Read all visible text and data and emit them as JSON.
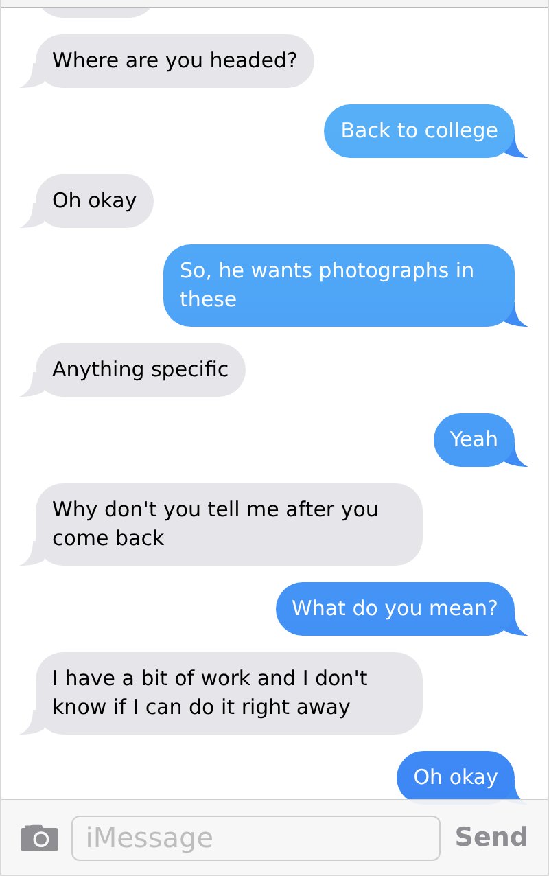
{
  "messages": [
    {
      "kind": "received"
    },
    {
      "kind": "received",
      "text": "Where are you headed?"
    },
    {
      "kind": "sent",
      "text": "Back to college"
    },
    {
      "kind": "received",
      "text": "Oh okay"
    },
    {
      "kind": "sent",
      "text": "So, he wants photographs in these"
    },
    {
      "kind": "received",
      "text": "Anything specific"
    },
    {
      "kind": "sent",
      "text": "Yeah"
    },
    {
      "kind": "received",
      "text": "Why don't you tell me after you come back"
    },
    {
      "kind": "sent",
      "text": "What do you mean?"
    },
    {
      "kind": "received",
      "text": "I have a bit of work and I don't know if I can do it right away"
    },
    {
      "kind": "sent",
      "text": "Oh okay"
    }
  ],
  "compose": {
    "placeholder": "iMessage",
    "send": "Send"
  }
}
